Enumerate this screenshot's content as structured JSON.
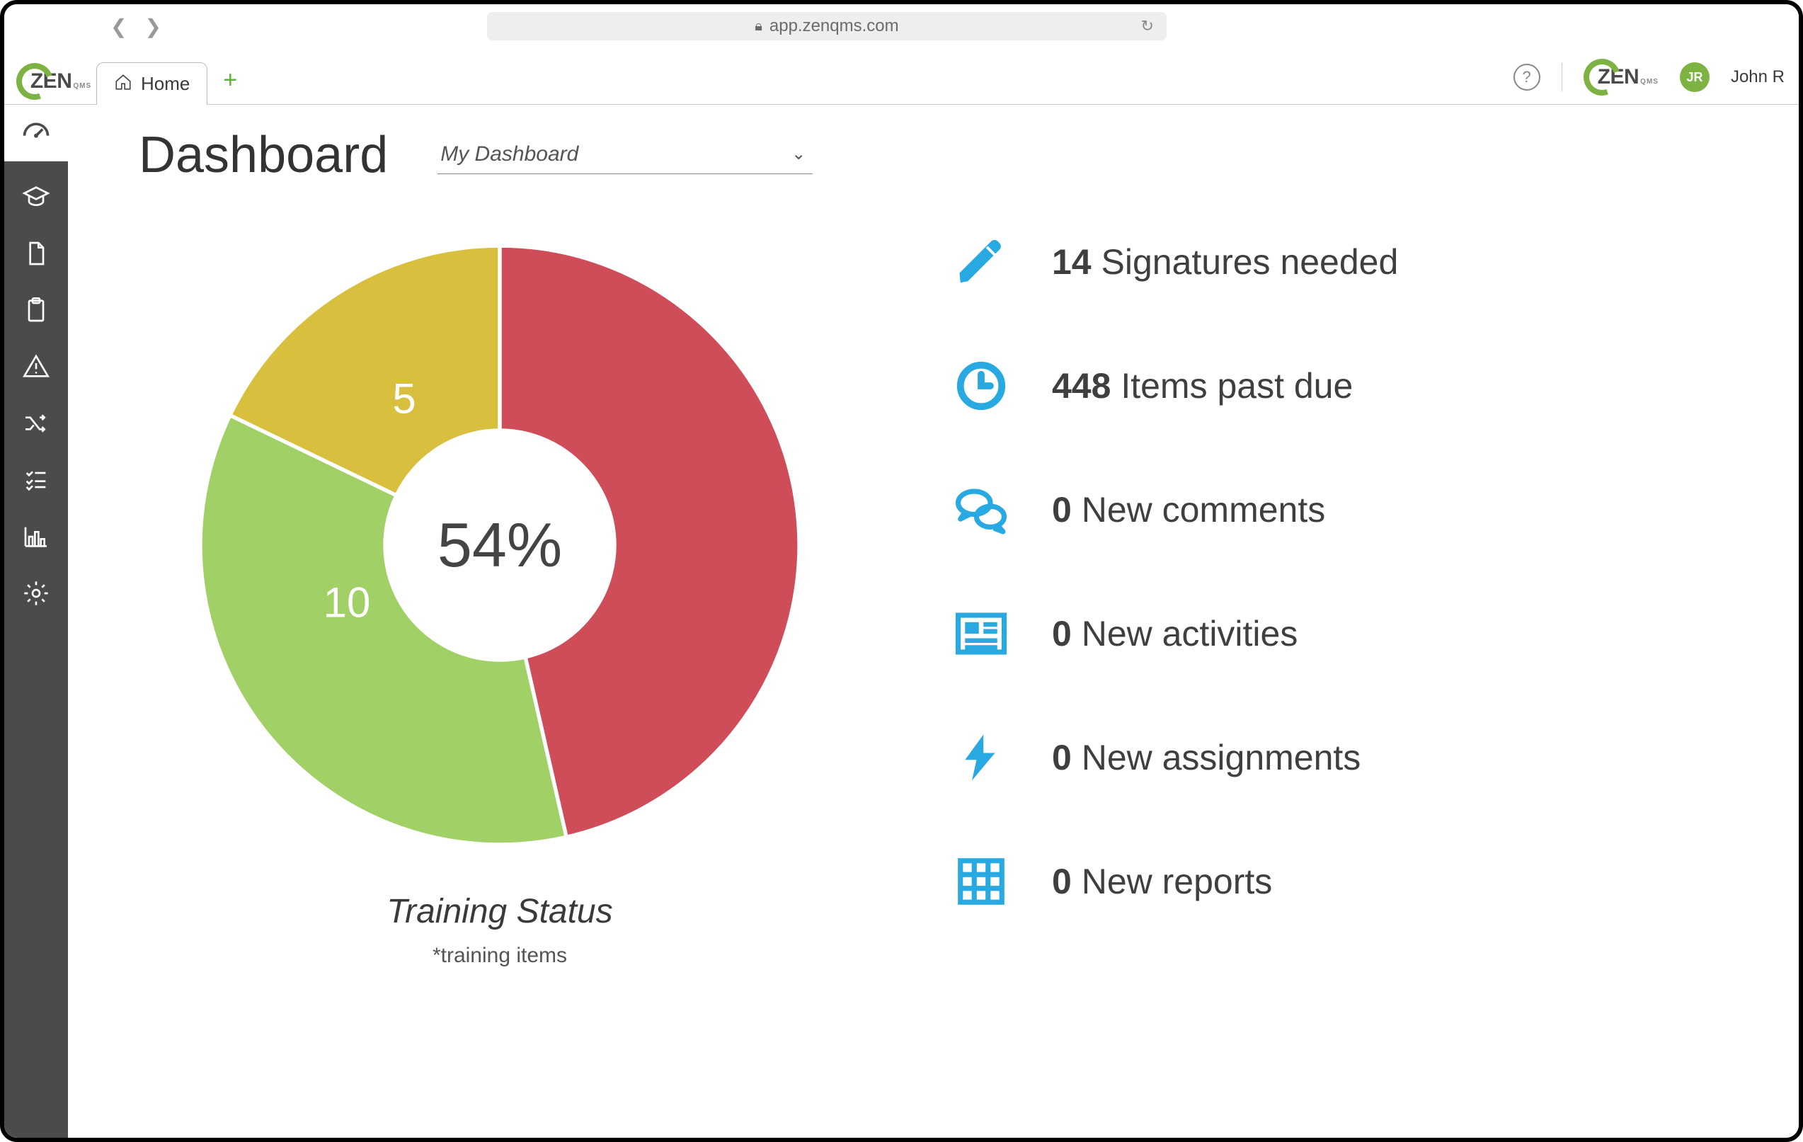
{
  "browser": {
    "url": "app.zenqms.com"
  },
  "header": {
    "logo_text": "ZEN",
    "logo_sub": "QMS",
    "tab_label": "Home",
    "help": "?",
    "user_initials": "JR",
    "user_name": "John R"
  },
  "page": {
    "title": "Dashboard",
    "selector_value": "My Dashboard"
  },
  "chart_data": {
    "type": "pie",
    "title": "Training Status",
    "subtitle": "*training items",
    "center_label": "54%",
    "series": [
      {
        "name": "red",
        "value": 13,
        "color": "#cf4d58"
      },
      {
        "name": "green",
        "value": 10,
        "color": "#a1d066"
      },
      {
        "name": "yellow",
        "value": 5,
        "color": "#d8bf3e"
      }
    ]
  },
  "stats": [
    {
      "icon": "pencil-icon",
      "count": 14,
      "label": "Signatures needed",
      "color": "#29a9e1"
    },
    {
      "icon": "clock-icon",
      "count": 448,
      "label": "Items past due",
      "color": "#29a9e1"
    },
    {
      "icon": "comments-icon",
      "count": 0,
      "label": "New comments",
      "color": "#29a9e1"
    },
    {
      "icon": "news-icon",
      "count": 0,
      "label": "New activities",
      "color": "#29a9e1"
    },
    {
      "icon": "bolt-icon",
      "count": 0,
      "label": "New assignments",
      "color": "#29a9e1"
    },
    {
      "icon": "grid-icon",
      "count": 0,
      "label": "New reports",
      "color": "#29a9e1"
    }
  ]
}
